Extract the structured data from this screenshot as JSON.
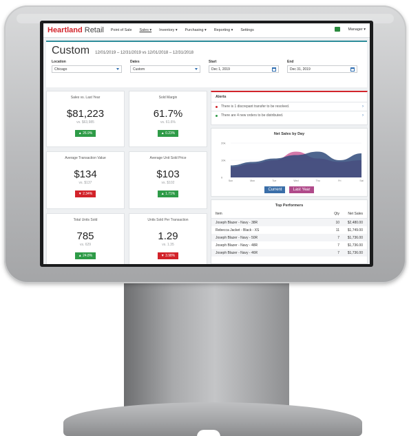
{
  "app": {
    "brand": "Heartland",
    "brand_sub": "Retail"
  },
  "nav": {
    "items": [
      "Point of Sale",
      "Sales ▾",
      "Inventory ▾",
      "Purchasing ▾",
      "Reporting ▾",
      "Settings"
    ],
    "user": "Manager ▾"
  },
  "header": {
    "title": "Custom",
    "date_range": "12/01/2019 – 12/31/2019 vs 12/01/2018 – 12/31/2018",
    "filters": [
      {
        "label": "Location",
        "value": "Chicago",
        "type": "select"
      },
      {
        "label": "Dates",
        "value": "Custom",
        "type": "select"
      },
      {
        "label": "Start",
        "value": "Dec 1, 2019",
        "type": "date"
      },
      {
        "label": "End",
        "value": "Dec 31, 2019",
        "type": "date"
      }
    ]
  },
  "kpis": [
    {
      "label": "Sales vs. Last Year",
      "value": "$81,223",
      "compare": "vs. $63,985",
      "change": "▲ 26.9%",
      "trend": "up"
    },
    {
      "label": "Sold Margin",
      "value": "61.7%",
      "compare": "vs. 61.6%",
      "change": "▲ 0.23%",
      "trend": "up"
    },
    {
      "label": "Average Transaction Value",
      "value": "$134",
      "compare": "vs. $137",
      "change": "▼ 2.34%",
      "trend": "down"
    },
    {
      "label": "Average Unit Sold Price",
      "value": "$103",
      "compare": "vs. $102",
      "change": "▲ 1.71%",
      "trend": "up"
    },
    {
      "label": "Total Units Sold",
      "value": "785",
      "compare": "vs. 629",
      "change": "▲ 24.8%",
      "trend": "up"
    },
    {
      "label": "Units Sold Per Transaction",
      "value": "1.29",
      "compare": "vs. 1.35",
      "change": "▼ 3.98%",
      "trend": "down"
    }
  ],
  "alerts": {
    "title": "Alerts",
    "items": [
      {
        "text": "There is 1 discrepant transfer to be resolved.",
        "color": "#d2232a"
      },
      {
        "text": "There are 4 new orders to be distributed.",
        "color": "#2e9b47"
      }
    ]
  },
  "chart_data": {
    "type": "area",
    "title": "Net Sales by Day",
    "categories": [
      "Sun",
      "Mon",
      "Tue",
      "Wed",
      "Thu",
      "Fri",
      "Sat"
    ],
    "yticks": [
      "20k",
      "10k",
      "0"
    ],
    "ylim": [
      0,
      20000
    ],
    "series": [
      {
        "name": "Current",
        "color": "#2f4a7a",
        "values": [
          7000,
          9000,
          11000,
          13000,
          15000,
          10000,
          14000
        ]
      },
      {
        "name": "Last Year",
        "color": "#c74b8c",
        "values": [
          6000,
          8000,
          10000,
          15000,
          11000,
          9000,
          10000
        ]
      }
    ],
    "legend": [
      "Current",
      "Last Year"
    ],
    "legend_colors": [
      "#3a6ea8",
      "#b04a8a"
    ]
  },
  "top_performers": {
    "title": "Top Performers",
    "columns": [
      "Item",
      "Qty",
      "Net Sales"
    ],
    "rows": [
      [
        "Joseph Blazer - Navy - 38R",
        "10",
        "$2,480.00"
      ],
      [
        "Rebecca Jacket - Black - XS",
        "11",
        "$1,749.00"
      ],
      [
        "Joseph Blazer - Navy - 50R",
        "7",
        "$1,736.00"
      ],
      [
        "Joseph Blazer - Navy - 48R",
        "7",
        "$1,736.00"
      ],
      [
        "Joseph Blazer - Navy - 46R",
        "7",
        "$1,736.00"
      ]
    ]
  }
}
